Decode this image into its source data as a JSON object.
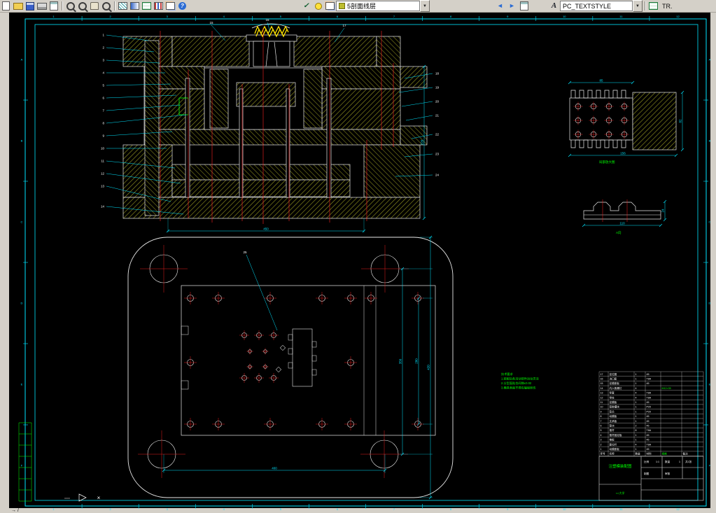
{
  "toolbar": {
    "layer_combo_value": "5剖面线层",
    "style_combo_value": "PC_TEXTSTYLE",
    "right_partial": "TR.",
    "glyphs": {
      "check": "✓",
      "undo": "◄",
      "redo": "►",
      "down": "▼",
      "letter": "A",
      "help": "?"
    }
  },
  "frame": {
    "numbers": [
      "1",
      "2",
      "3",
      "4",
      "5",
      "6",
      "7",
      "8",
      "9",
      "10",
      "11",
      "12"
    ],
    "letters": [
      "A",
      "B",
      "C",
      "D",
      "E",
      "F"
    ]
  },
  "callouts": [
    "1",
    "2",
    "3",
    "4",
    "5",
    "6",
    "7",
    "8",
    "9",
    "10",
    "11",
    "12",
    "13",
    "14",
    "15",
    "16",
    "17",
    "18",
    "19",
    "20",
    "21",
    "22",
    "23",
    "24",
    "25"
  ],
  "dims": {
    "section_w": "450",
    "section_h": "220",
    "plan_pitch": "350",
    "plan_inner": "280",
    "plan_h": "420",
    "plan_w": "400",
    "detail_w": "85",
    "detail_h": "82",
    "detail_total": "156",
    "side_w": "110",
    "side_h": "24"
  },
  "notes": {
    "lines": [
      "技术要求",
      "1.装配后各活动部件运动灵活",
      "2.分型面贴合间隙≤0.02",
      "3.模具表面不得有磕碰划伤"
    ]
  },
  "labels": {
    "detail_view": "局部放大图",
    "side_view": "A向"
  },
  "titleblock": {
    "header": [
      "序号",
      "名称",
      "数量",
      "材料",
      "规格",
      "备注"
    ],
    "rows": [
      [
        "17",
        "定位圈",
        "1",
        "45",
        "",
        ""
      ],
      [
        "16",
        "浇口套",
        "1",
        "T8A",
        "",
        ""
      ],
      [
        "15",
        "定模座板",
        "1",
        "45",
        "",
        ""
      ],
      [
        "14",
        "内六角螺钉",
        "4",
        "",
        "M12×35",
        ""
      ],
      [
        "13",
        "导套",
        "4",
        "T8A",
        "",
        ""
      ],
      [
        "12",
        "导柱",
        "4",
        "T8A",
        "",
        ""
      ],
      [
        "11",
        "定模板",
        "1",
        "45",
        "",
        ""
      ],
      [
        "10",
        "型腔镶块",
        "1",
        "P20",
        "",
        ""
      ],
      [
        "9",
        "型芯",
        "1",
        "P20",
        "",
        ""
      ],
      [
        "8",
        "动模板",
        "1",
        "45",
        "",
        ""
      ],
      [
        "7",
        "支承板",
        "1",
        "45",
        "",
        ""
      ],
      [
        "6",
        "垫块",
        "2",
        "45",
        "",
        ""
      ],
      [
        "5",
        "推杆",
        "8",
        "T8A",
        "",
        ""
      ],
      [
        "4",
        "推杆固定板",
        "1",
        "45",
        "",
        ""
      ],
      [
        "3",
        "推板",
        "1",
        "45",
        "",
        ""
      ],
      [
        "2",
        "复位杆",
        "4",
        "T8A",
        "",
        ""
      ],
      [
        "1",
        "动模座板",
        "1",
        "45",
        "",
        ""
      ]
    ],
    "title": "注塑模装配图",
    "school": "××大学",
    "fields": {
      "scale_label": "比例",
      "scale_value": "1:1",
      "qty_label": "数量",
      "qty_value": "1",
      "sheet": "共1张",
      "drawn": "制图",
      "checked": "审核"
    }
  },
  "statusbar": {
    "marks": "→ /"
  },
  "misc": {
    "x_mark": "×"
  },
  "colors": {
    "cyan": "#00e5ff",
    "red": "#ff2020",
    "green": "#00ff00",
    "hatch": "#8f8f20",
    "yellow": "#ffe400"
  }
}
